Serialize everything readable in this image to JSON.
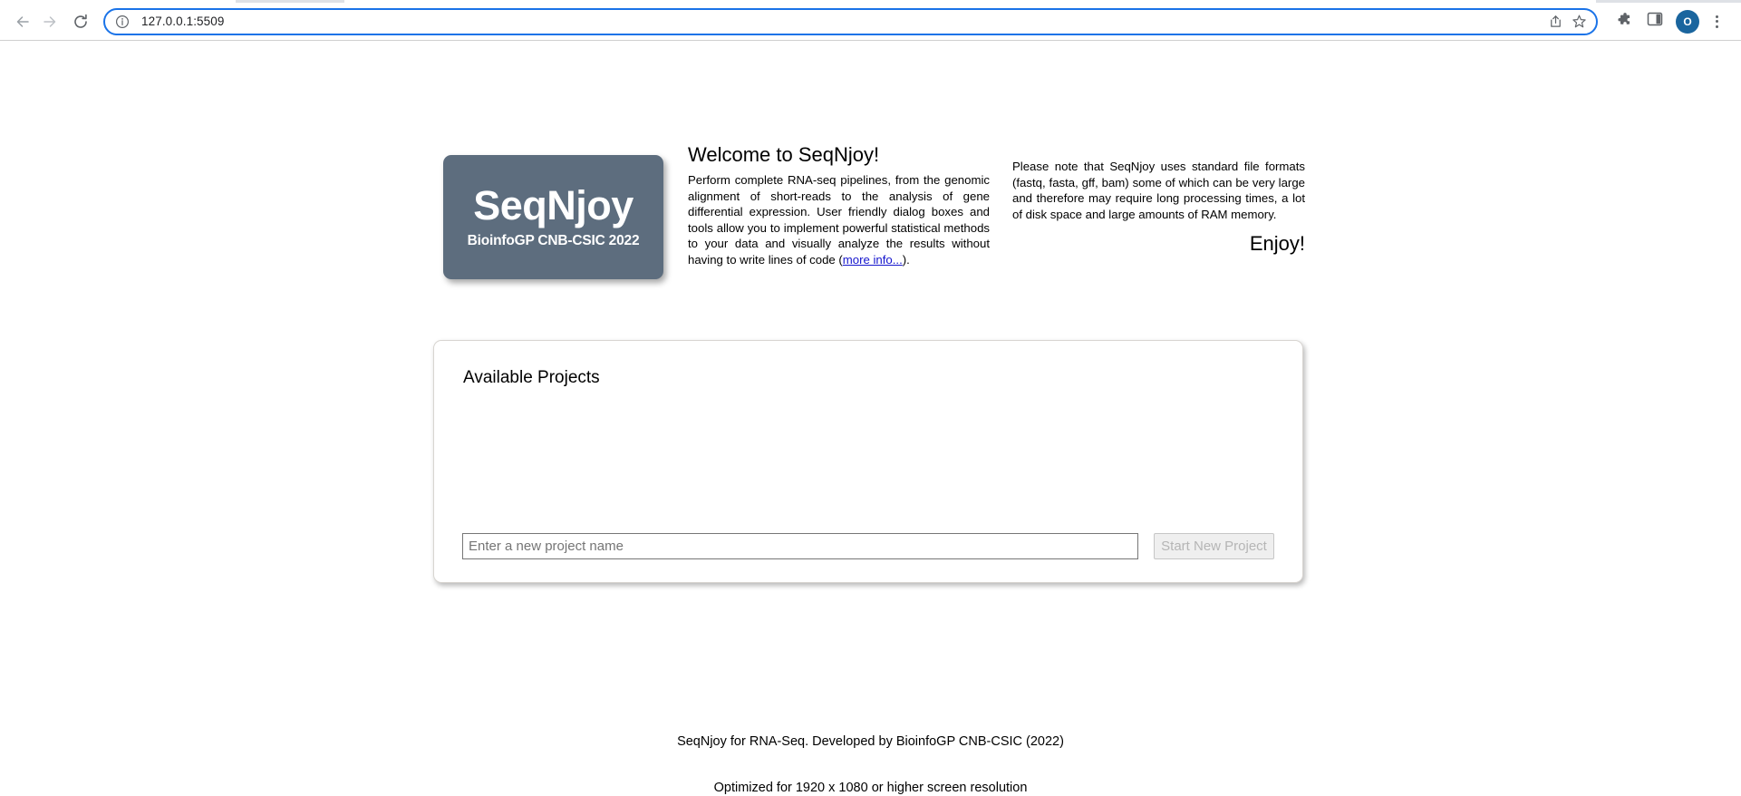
{
  "browser": {
    "back_icon": "back-arrow-icon",
    "forward_icon": "forward-arrow-icon",
    "reload_icon": "reload-icon",
    "site_info_icon": "info-circle-icon",
    "url": "127.0.0.1:5509",
    "share_icon": "share-icon",
    "bookmark_icon": "bookmark-star-icon",
    "extensions_icon": "extensions-puzzle-icon",
    "sidepanel_icon": "side-panel-icon",
    "avatar_label": "O",
    "menu_icon": "three-dot-menu-icon",
    "accent_color": "#1a73e8",
    "avatar_color": "#1a659e"
  },
  "logo": {
    "title": "SeqNjoy",
    "subtitle": "BioinfoGP CNB-CSIC 2022",
    "background_color": "#5d6d7e"
  },
  "welcome": {
    "heading": "Welcome to SeqNjoy!",
    "paragraph_before_link": "Perform complete RNA-seq pipelines, from the genomic alignment of short-reads to the analysis of gene differential expression. User friendly dialog boxes and tools allow you to implement powerful statistical methods to your data and visually analyze the results without having to write lines of code (",
    "link_text": "more info...",
    "paragraph_after_link": ")."
  },
  "note": {
    "text": "Please note that SeqNjoy uses standard file formats (fastq, fasta, gff, bam) some of which can be very large and therefore may require long processing times, a lot of disk space and large amounts of RAM memory.",
    "enjoy": "Enjoy!"
  },
  "projects": {
    "title": "Available Projects",
    "items": [],
    "input_placeholder": "Enter a new project name",
    "input_value": "",
    "start_button_label": "Start New Project",
    "start_button_disabled": true
  },
  "footer": {
    "line1": "SeqNjoy for RNA-Seq. Developed by BioinfoGP CNB-CSIC (2022)",
    "line2": "Optimized for 1920 x 1080 or higher screen resolution"
  }
}
